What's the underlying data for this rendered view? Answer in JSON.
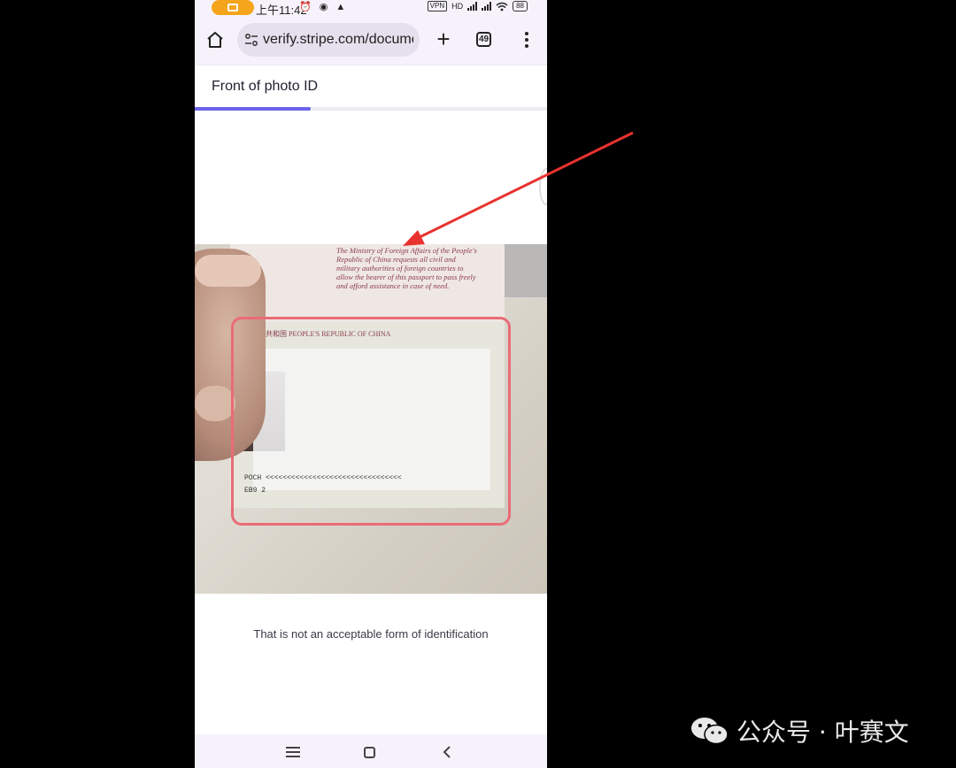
{
  "status_bar": {
    "time": "上午11:42",
    "left_icons": "⏰ ◉ ▲",
    "vpn_label": "VPN",
    "signal_label": "HD",
    "battery": "88"
  },
  "browser": {
    "url": "verify.stripe.com/document",
    "tab_count": "49",
    "new_tab_glyph": "+"
  },
  "page": {
    "title": "Front of photo ID",
    "progress": 0.33,
    "message": "That is not an acceptable form of identification"
  },
  "photo": {
    "book_text": "The Ministry of Foreign Affairs of the People's Republic of China requests all civil and military authorities of foreign countries to allow the bearer of this passport to pass freely and afford assistance in case of need.",
    "passport_header": "中华人民共和国   PEOPLE'S REPUBLIC OF CHINA",
    "mrz_line1": "POCH  <<<<<<<<<<<<<<<<<<<<<<<<<<<<<<<<",
    "mrz_line2": "EB9                                              2"
  },
  "watermark": {
    "text": "公众号 · 叶赛文"
  },
  "colors": {
    "accent": "#6b63e8",
    "frame": "#e96c76",
    "arrow": "#e8322f"
  }
}
